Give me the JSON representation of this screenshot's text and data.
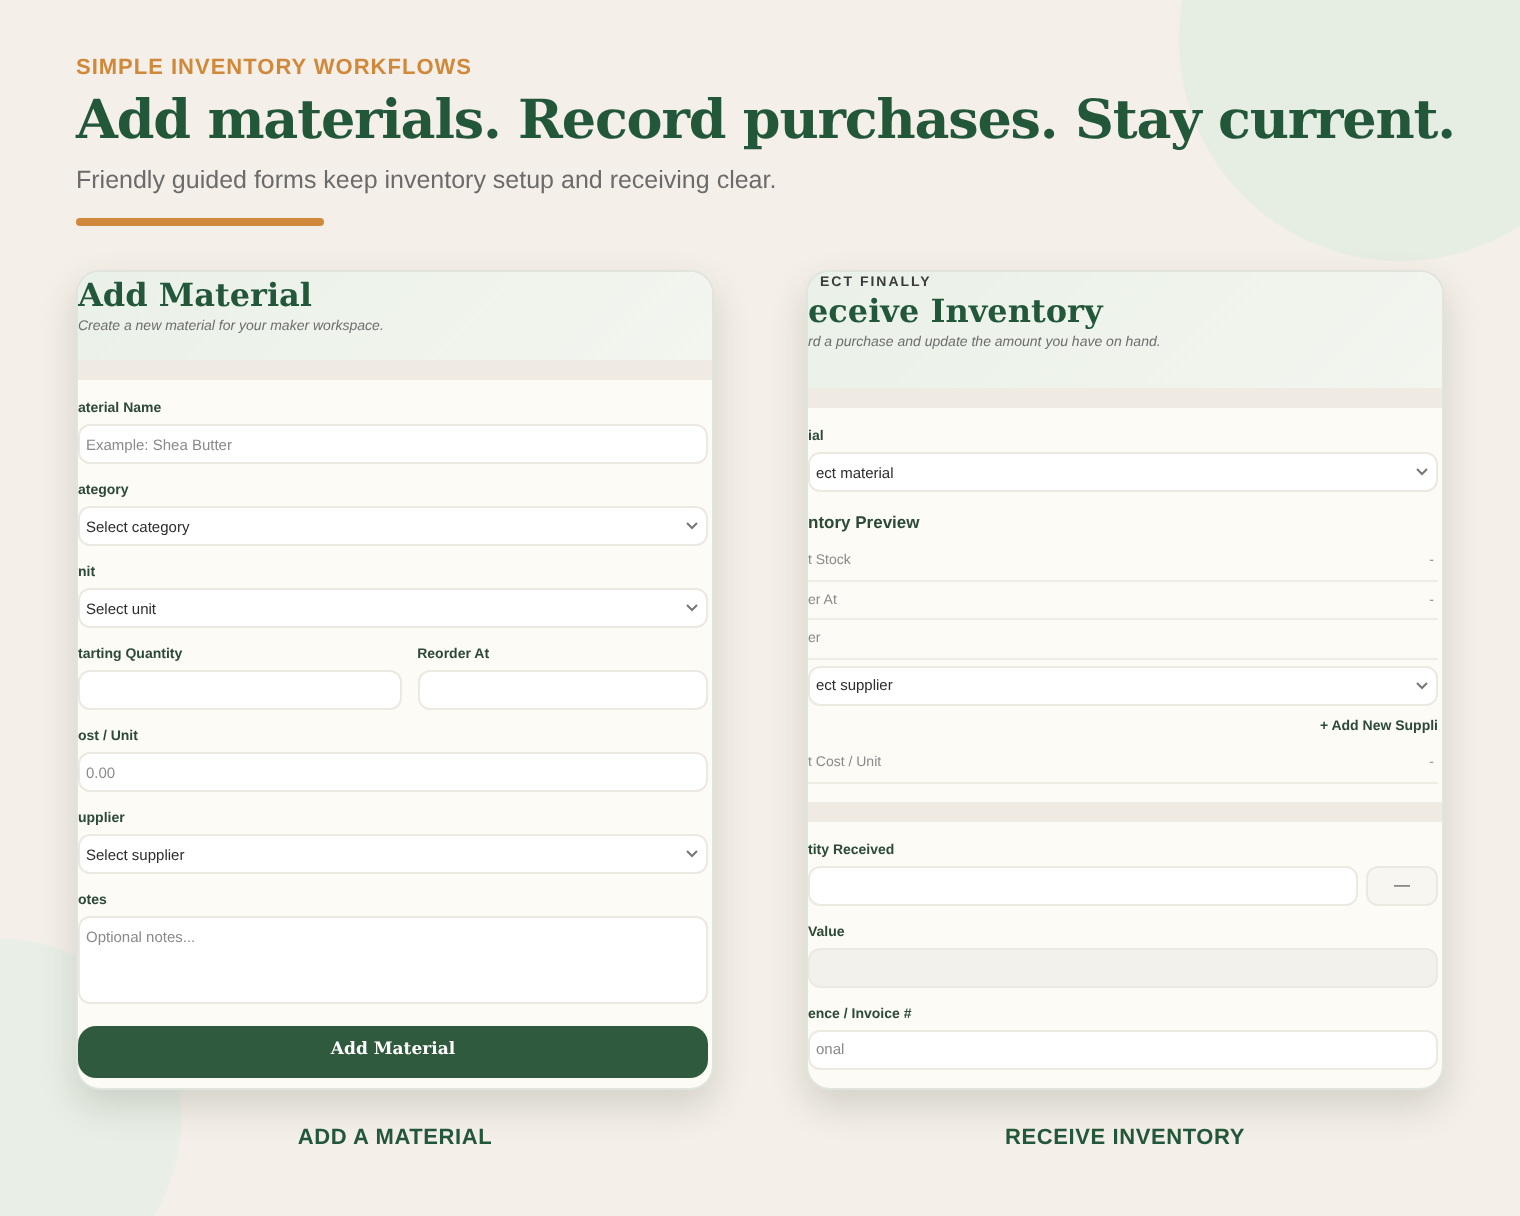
{
  "eyebrow": "SIMPLE INVENTORY WORKFLOWS",
  "headline": "Add materials. Record purchases. Stay current.",
  "subheadline": "Friendly guided forms keep inventory setup and receiving clear.",
  "cards": [
    {
      "title": "Add Material",
      "subtitle": "Create a new material for your maker workspace.",
      "caption": "ADD A MATERIAL",
      "button": "Add Material",
      "sections": [
        [
          {
            "kind": "input",
            "label": "aterial Name",
            "placeholder": "Example: Shea Butter"
          },
          {
            "kind": "select",
            "label": "ategory",
            "value": "Select category"
          },
          {
            "kind": "select",
            "label": "nit",
            "value": "Select unit"
          },
          {
            "kind": "pair",
            "items": [
              {
                "label": "tarting Quantity"
              },
              {
                "label": "Reorder At"
              }
            ]
          },
          {
            "kind": "input",
            "label": "ost / Unit",
            "placeholder": "0.00"
          },
          {
            "kind": "select",
            "label": "upplier",
            "value": "Select supplier"
          },
          {
            "kind": "textarea",
            "label": "otes",
            "placeholder": "Optional notes..."
          }
        ]
      ]
    },
    {
      "eyebrow": "ECT FINALLY",
      "title": "eceive Inventory",
      "subtitle": "rd a purchase and update the amount you have on hand.",
      "caption": "RECEIVE INVENTORY",
      "sections": [
        [
          {
            "kind": "select",
            "label": "ial",
            "value": "ect material"
          },
          {
            "kind": "heading",
            "text": "ntory Preview"
          },
          {
            "kind": "stat",
            "label": "t Stock",
            "value": "-"
          },
          {
            "kind": "stat",
            "label": "er At",
            "value": "-"
          },
          {
            "kind": "stat",
            "label": "er"
          },
          {
            "kind": "select",
            "value": "ect supplier"
          },
          {
            "kind": "link",
            "text": "+ Add New Suppli"
          },
          {
            "kind": "stat",
            "label": "t Cost / Unit",
            "value": "-"
          }
        ],
        [
          {
            "kind": "stepper",
            "label": "tity Received",
            "button": "—"
          },
          {
            "kind": "readonly",
            "label": "Value"
          },
          {
            "kind": "input",
            "label": "ence / Invoice #",
            "placeholder": "onal"
          }
        ]
      ]
    }
  ]
}
